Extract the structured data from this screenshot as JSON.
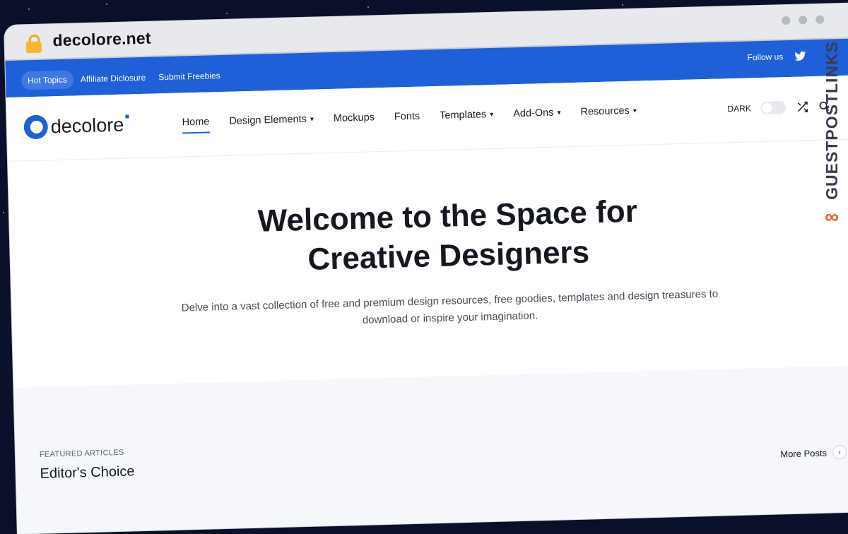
{
  "browser": {
    "domain": "decolore.net"
  },
  "topbar": {
    "pill": "Hot Topics",
    "links": [
      "Affiliate Diclosure",
      "Submit Freebies"
    ],
    "follow": "Follow us"
  },
  "nav": {
    "logo": "decolore",
    "menu": [
      "Home",
      "Design Elements",
      "Mockups",
      "Fonts",
      "Templates",
      "Add-Ons",
      "Resources"
    ],
    "dark_label": "DARK"
  },
  "hero": {
    "title_line1": "Welcome to the Space for",
    "title_line2": "Creative Designers",
    "subtitle": "Delve into a vast collection of free and premium design resources, free goodies, templates and design treasures to download or inspire your imagination."
  },
  "featured": {
    "label": "FEATURED ARTICLES",
    "title": "Editor's Choice",
    "more": "More Posts"
  },
  "watermark": {
    "text": "GUESTPOSTLINKS"
  },
  "colors": {
    "brand": "#1f5fd8",
    "accent": "#f05a28"
  }
}
